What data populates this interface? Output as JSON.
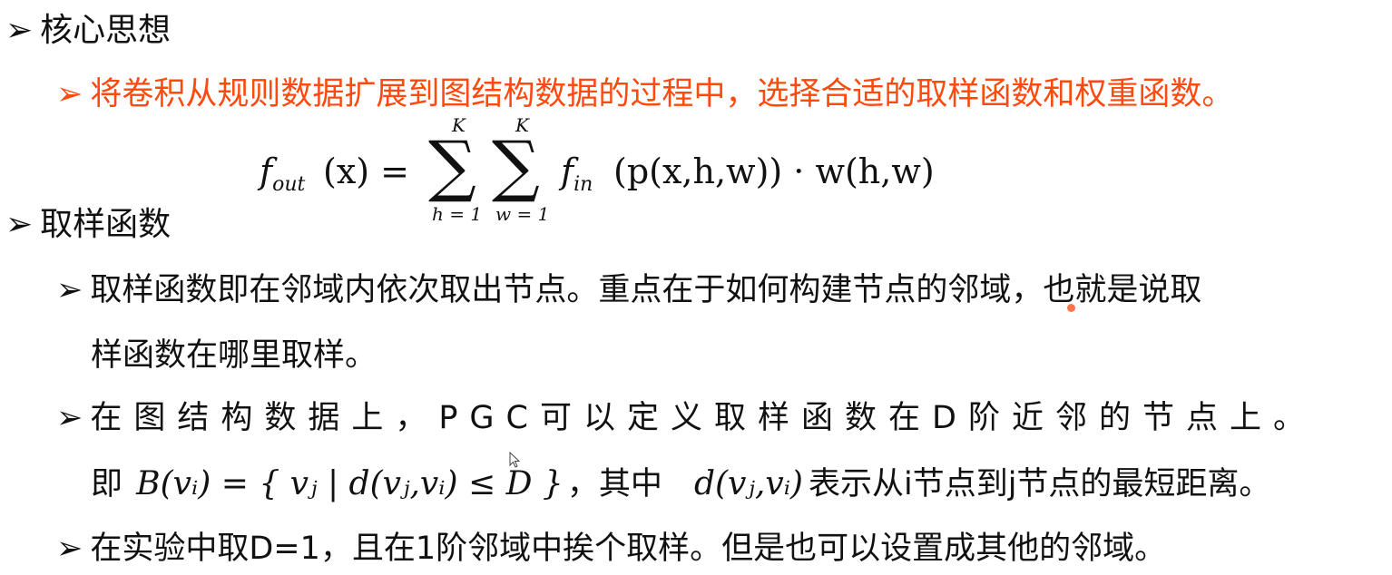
{
  "bullets": {
    "core_idea": "核心思想",
    "core_idea_detail": "将卷积从规则数据扩展到图结构数据的过程中，选择合适的取样函数和权重函数。",
    "sampling_function": "取样函数",
    "sampling_def_line1": "取样函数即在邻域内依次取出节点。重点在于如何构建节点的邻域，也就是说取",
    "sampling_def_line2": "样函数在哪里取样。",
    "pgc_line1": "在图结构数据上，PGC可以定义取样函数在D阶近邻的节点上。",
    "pgc_line2_prefix": "即",
    "pgc_line2_middle": "，其中",
    "pgc_line2_suffix": "表示从i节点到j节点的最短距离。",
    "experiment": "在实验中取D=1，且在1阶邻域中挨个取样。但是也可以设置成其他的邻域。"
  },
  "formula": {
    "lhs_f": "f",
    "lhs_sub": "out",
    "lhs_arg": "(x) =",
    "sum1_upper": "K",
    "sum1_lower": "h = 1",
    "sum2_upper": "K",
    "sum2_lower": "w = 1",
    "fin": "f",
    "fin_sub": "in",
    "rhs": "(p(x,h,w)) · w(h,w)"
  },
  "inline_math": {
    "neighborhood": "B(vᵢ) = { vⱼ | d(vⱼ,vᵢ) ≤ D }",
    "distance": "d(vⱼ,vᵢ)"
  },
  "icons": {
    "bullet": "arrowhead-bullet-icon"
  },
  "colors": {
    "highlight": "#fe4a0e",
    "text": "#111111"
  }
}
